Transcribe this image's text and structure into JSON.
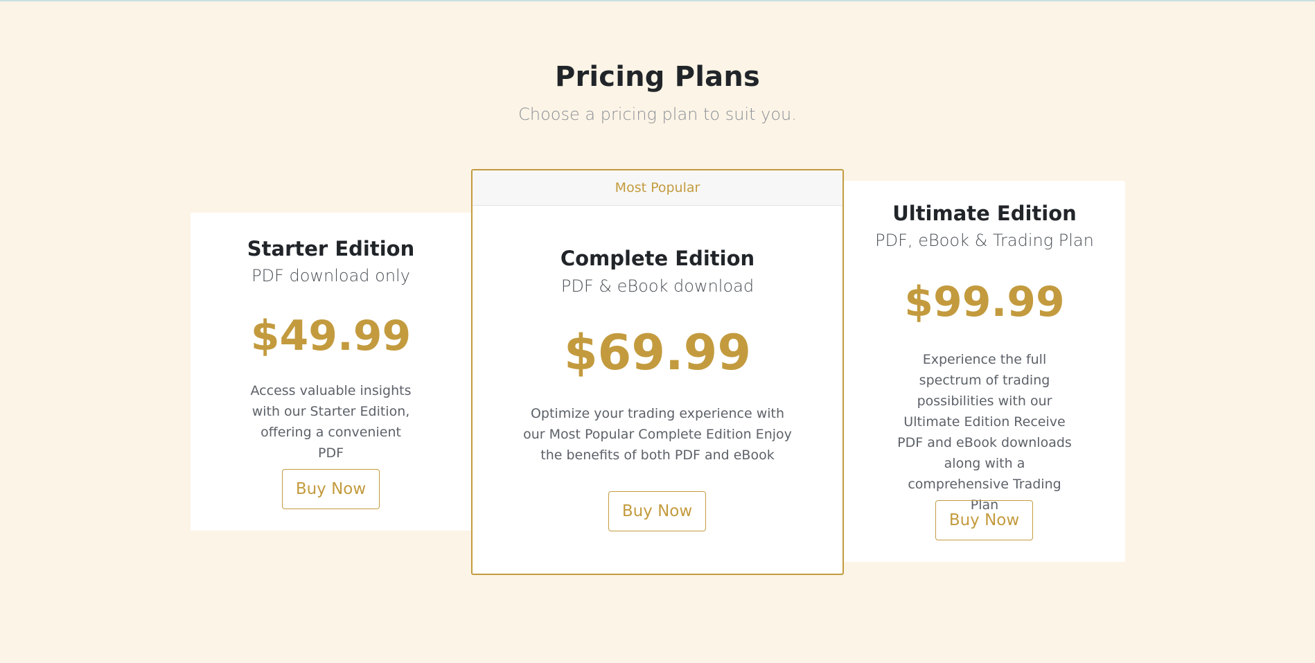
{
  "header": {
    "title": "Pricing Plans",
    "subtitle": "Choose a pricing plan to suit you."
  },
  "plans": [
    {
      "title": "Starter Edition",
      "subtitle": "PDF download only",
      "price": "$49.99",
      "description": "Access valuable insights with our Starter Edition, offering a convenient PDF",
      "button_label": "Buy Now"
    },
    {
      "badge": "Most Popular",
      "title": "Complete Edition",
      "subtitle": "PDF & eBook download",
      "price": "$69.99",
      "description": "Optimize your trading experience with our Most Popular Complete Edition Enjoy the benefits of both PDF and eBook",
      "button_label": "Buy Now"
    },
    {
      "title": "Ultimate Edition",
      "subtitle": "PDF, eBook & Trading Plan",
      "price": "$99.99",
      "description": "Experience the full spectrum of trading possibilities with our Ultimate Edition Receive PDF and eBook downloads along with a comprehensive Trading Plan",
      "button_label": "Buy Now"
    }
  ],
  "colors": {
    "background": "#fcf4e6",
    "accent": "#c39b3e",
    "card": "#ffffff"
  }
}
